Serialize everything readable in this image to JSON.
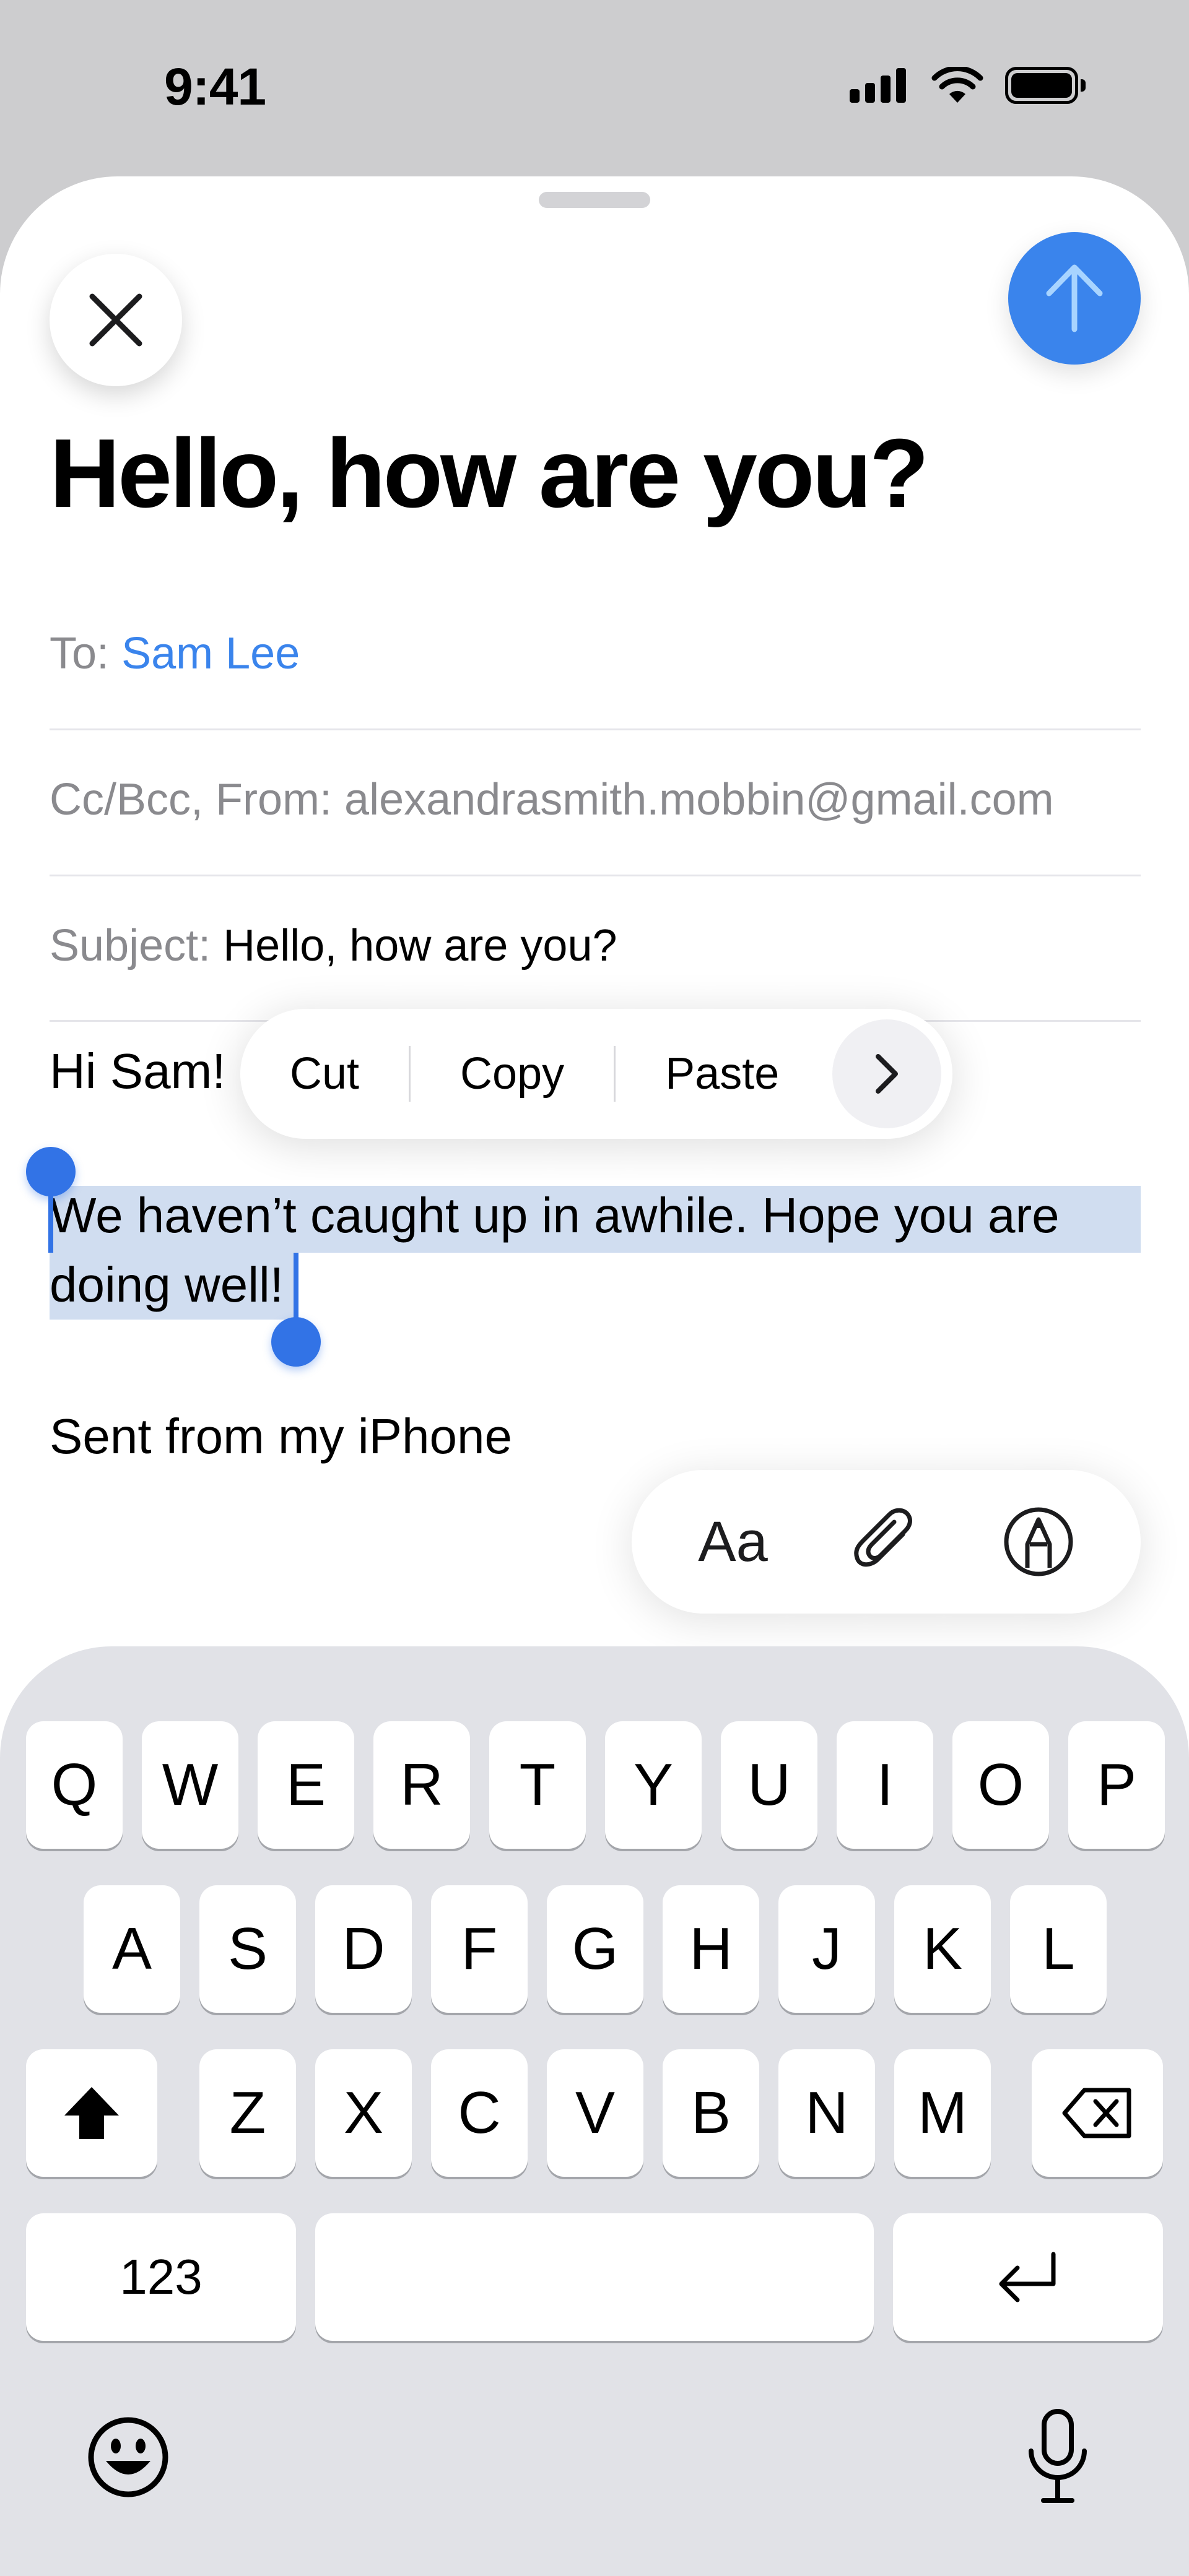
{
  "status_bar": {
    "time": "9:41"
  },
  "compose": {
    "title": "Hello, how are you?",
    "to_label": "To:",
    "to_value": "Sam Lee",
    "cc_label": "Cc/Bcc, From:",
    "cc_value": "alexandrasmith.mobbin@gmail.com",
    "subject_label": "Subject:",
    "subject_value": "Hello, how are you?",
    "greeting": "Hi Sam!",
    "body_line1": "We haven’t caught up in awhile. Hope you are",
    "body_line2": "doing well!",
    "signature": "Sent from my iPhone"
  },
  "edit_menu": {
    "cut": "Cut",
    "copy": "Copy",
    "paste": "Paste"
  },
  "format_toolbar": {
    "text_format_label": "Aa"
  },
  "keyboard": {
    "row1": [
      "Q",
      "W",
      "E",
      "R",
      "T",
      "Y",
      "U",
      "I",
      "O",
      "P"
    ],
    "row2": [
      "A",
      "S",
      "D",
      "F",
      "G",
      "H",
      "J",
      "K",
      "L"
    ],
    "row3": [
      "Z",
      "X",
      "C",
      "V",
      "B",
      "N",
      "M"
    ],
    "numbers_key": "123"
  },
  "colors": {
    "accent": "#3a84ec",
    "selection": "#d0ddf0",
    "handle": "#3273e6"
  }
}
